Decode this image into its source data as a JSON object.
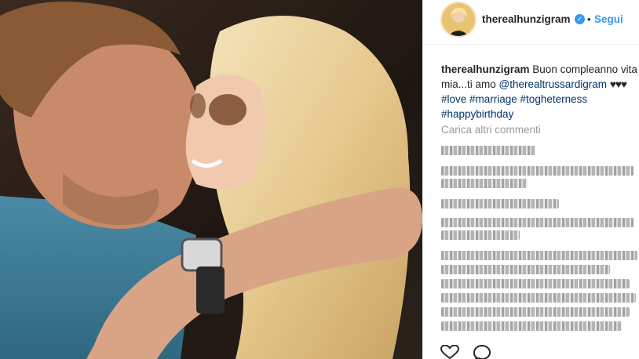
{
  "post": {
    "username": "therealhunzigram",
    "follow_label": "Segui",
    "separator": "•",
    "verified_glyph": "✓"
  },
  "caption": {
    "user": "therealhunzigram",
    "line1_text": "Buon compleanno vita",
    "line2_text": "mia...ti amo",
    "mention": "@therealtrussardigram",
    "hearts": "♥♥♥",
    "hashtags_line1": "#love #marriage #togheterness",
    "hashtags_line2": "#happybirthday"
  },
  "comments": {
    "load_more": "Carica altri commenti"
  },
  "icons": {
    "heart": "heart-icon",
    "comment": "comment-icon",
    "verified": "verified-badge-icon"
  },
  "colors": {
    "link": "#3897f0",
    "hashtag": "#003569",
    "muted": "#999999"
  }
}
